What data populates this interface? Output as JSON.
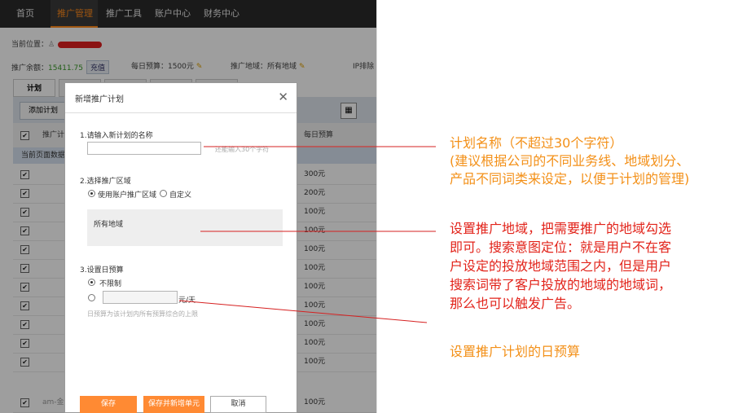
{
  "nav": {
    "items": [
      "首页",
      "推广管理",
      "推广工具",
      "账户中心",
      "财务中心"
    ],
    "active_index": 1
  },
  "breadcrumb": {
    "label": "当前位置："
  },
  "info": {
    "balance_label": "推广余额：",
    "balance_value": "15411.75",
    "recharge_label": "充值",
    "daily_budget": "每日预算：1500元",
    "region": "推广地域：所有地域",
    "extra": "IP排除"
  },
  "tabs": {
    "first": "计划"
  },
  "toolbar": {
    "add_plan": "添加计划"
  },
  "table": {
    "col_plan": "推广计",
    "col_budget": "每日预算",
    "group_row": "当前页面数据",
    "row_budgets": [
      "300元",
      "200元",
      "100元",
      "100元",
      "100元",
      "100元",
      "100元",
      "100元",
      "100元",
      "100元",
      "100元",
      "100元"
    ],
    "last_row_name": "am-金"
  },
  "dialog": {
    "title": "新增推广计划",
    "step1_label": "1.请输入新计划的名称",
    "step1_hint": "还能输入30个字符",
    "step2_label": "2.选择推广区域",
    "step2_opt1": "使用账户推广区域",
    "step2_opt2": "自定义",
    "region_text": "所有地域",
    "step3_label": "3.设置日预算",
    "step3_opt1": "不限制",
    "budget_unit": "元/天",
    "budget_hint": "日预算为该计划内所有预算综合的上限",
    "save": "保存",
    "save_and_add": "保存并新增单元",
    "cancel": "取消"
  },
  "annotations": {
    "a1_line1": "计划名称（不超过30个字符）",
    "a1_line2": "(建议根据公司的不同业务线、地域划分、",
    "a1_line3": "产品不同词类来设定，以便于计划的管理)",
    "a2_line1": "设置推广地域，把需要推广的地域勾选",
    "a2_line2": "即可。搜索意图定位：就是用户不在客",
    "a2_line3": "户设定的投放地域范围之内，但是用户",
    "a2_line4": "搜索词带了客户投放的地域的地域词，",
    "a2_line5": "那么也可以触发广告。",
    "a3": "设置推广计划的日预算"
  },
  "colors": {
    "accent": "#ff8a33",
    "annotation_orange": "#f39018",
    "annotation_red": "#e2231a",
    "line_red": "#d62020"
  }
}
